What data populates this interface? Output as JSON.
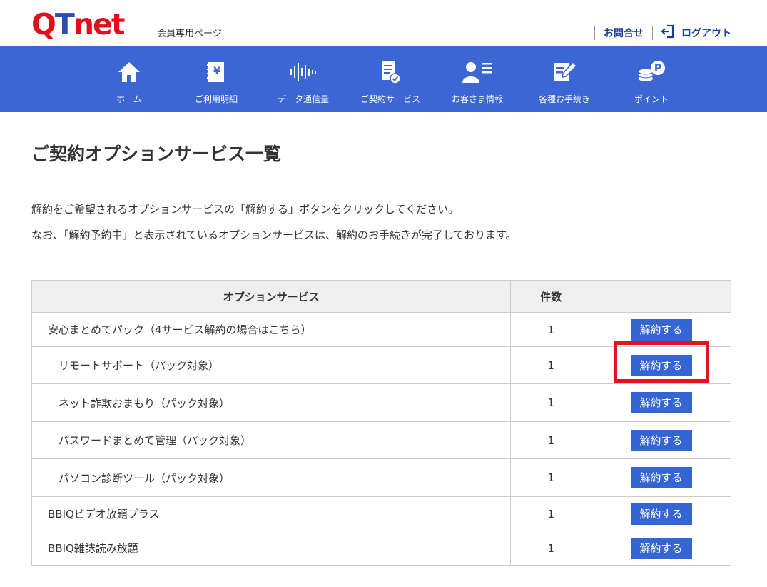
{
  "header": {
    "logo_primary": "QTnet",
    "logo_sub": "会員専用ページ",
    "contact_label": "お問合せ",
    "logout_label": "ログアウト"
  },
  "nav": {
    "items": [
      {
        "label": "ホーム",
        "icon": "home-icon"
      },
      {
        "label": "ご利用明細",
        "icon": "invoice-icon"
      },
      {
        "label": "データ通信量",
        "icon": "signal-wave-icon"
      },
      {
        "label": "ご契約サービス",
        "icon": "contract-icon"
      },
      {
        "label": "お客さま情報",
        "icon": "user-info-icon"
      },
      {
        "label": "各種お手続き",
        "icon": "form-edit-icon"
      },
      {
        "label": "ポイント",
        "icon": "points-coin-icon"
      }
    ]
  },
  "main": {
    "title": "ご契約オプションサービス一覧",
    "description": [
      "解約をご希望されるオプションサービスの「解約する」ボタンをクリックしてください。",
      "なお、「解約予約中」と表示されているオプションサービスは、解約のお手続きが完了しております。"
    ]
  },
  "table": {
    "headers": [
      "オプションサービス",
      "件数",
      ""
    ],
    "rows": [
      {
        "name": "安心まとめてパック（4サービス解約の場合はこちら）",
        "count": "1",
        "action": "解約する"
      },
      {
        "name": "リモートサポート（パック対象）",
        "count": "1",
        "action": "解約する"
      },
      {
        "name": "ネット詐欺おまもり（パック対象）",
        "count": "1",
        "action": "解約する"
      },
      {
        "name": "パスワードまとめて管理（パック対象）",
        "count": "1",
        "action": "解約する"
      },
      {
        "name": "パソコン診断ツール（パック対象）",
        "count": "1",
        "action": "解約する"
      },
      {
        "name": "BBIQビデオ放題プラス",
        "count": "1",
        "action": "解約する"
      },
      {
        "name": "BBIQ雑誌読み放題",
        "count": "1",
        "action": "解約する"
      }
    ]
  },
  "colors": {
    "nav_bg": "#3b66d4",
    "button_bg": "#3565d4",
    "highlight": "#e4141d",
    "logo_red": "#e0101a",
    "link_blue": "#1c3d9c"
  }
}
